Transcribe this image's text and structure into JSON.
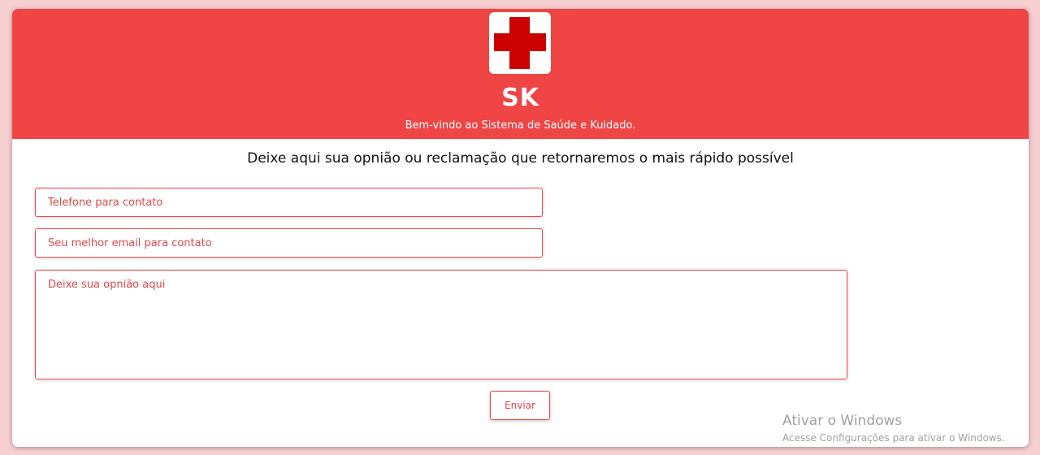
{
  "header": {
    "logo_icon": "red-cross-icon",
    "brand": "SK",
    "welcome": "Bem-vindo ao Sistema de Saúde e Kuidado."
  },
  "form": {
    "headline": "Deixe aqui sua opnião ou reclamação que retornaremos o mais rápido possível",
    "phone": {
      "value": "",
      "placeholder": "Telefone para contato"
    },
    "email": {
      "value": "",
      "placeholder": "Seu melhor email para contato"
    },
    "opinion": {
      "value": "",
      "placeholder": "Deixe sua opnião aqui"
    },
    "submit_label": "Enviar"
  },
  "watermark": {
    "title": "Ativar o Windows",
    "subtitle": "Acesse Configurações para ativar o Windows."
  },
  "colors": {
    "page_background": "#f6cfd1",
    "header_background": "#ef4545",
    "cross": "#cc0000",
    "accent": "#e84a4a"
  }
}
